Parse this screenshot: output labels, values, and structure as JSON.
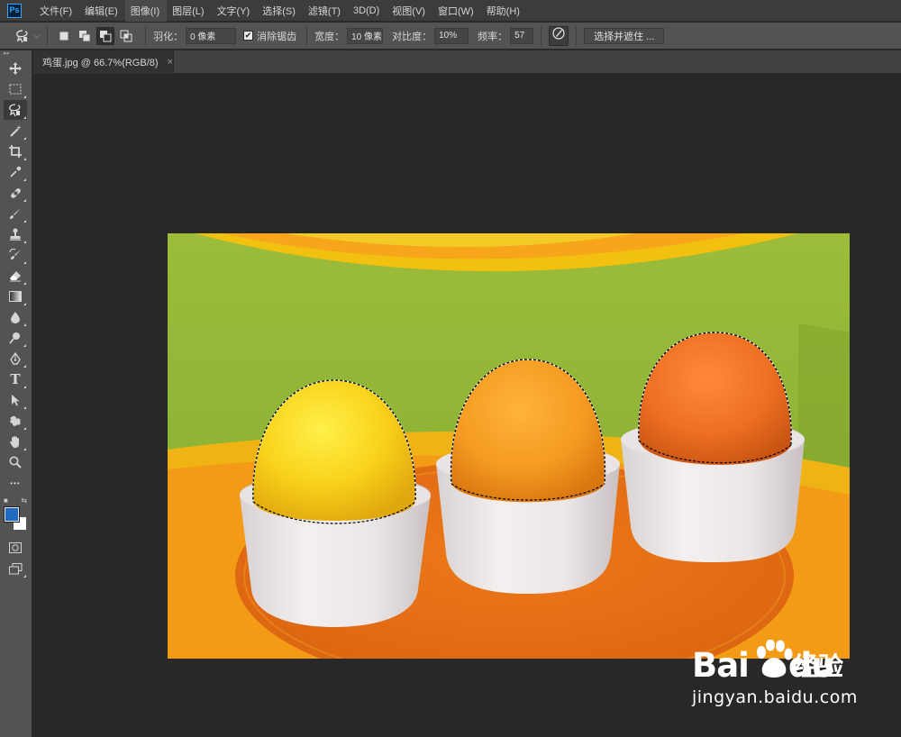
{
  "app": {
    "logo_text": "Ps",
    "menu": [
      {
        "label": "文件(F)"
      },
      {
        "label": "编辑(E)"
      },
      {
        "label": "图像(I)"
      },
      {
        "label": "图层(L)"
      },
      {
        "label": "文字(Y)"
      },
      {
        "label": "选择(S)"
      },
      {
        "label": "滤镜(T)"
      },
      {
        "label": "3D(D)"
      },
      {
        "label": "视图(V)"
      },
      {
        "label": "窗口(W)"
      },
      {
        "label": "帮助(H)"
      }
    ],
    "active_menu": "图像(I)"
  },
  "options": {
    "tool_icon": "magnetic-lasso-icon",
    "selection_modes": [
      "new-selection",
      "add-to-selection",
      "subtract-from-selection",
      "intersect-with-selection"
    ],
    "selected_mode": "subtract-from-selection",
    "feather_label": "羽化：",
    "feather_value": "0 像素",
    "antialias_label": "消除锯齿",
    "antialias_checked": true,
    "width_label": "宽度：",
    "width_value": "10 像素",
    "contrast_label": "对比度：",
    "contrast_value": "10%",
    "frequency_label": "频率：",
    "frequency_value": "57",
    "pen_pressure_icon": "pen-pressure-icon",
    "select_mask_label": "选择并遮住 ..."
  },
  "toolbox": {
    "grip": "▸▸",
    "tools": [
      {
        "name": "move-tool",
        "icon": "move-icon"
      },
      {
        "name": "marquee-tool",
        "icon": "rect-marquee-icon"
      },
      {
        "name": "lasso-tool",
        "icon": "magnetic-lasso-icon",
        "active": true
      },
      {
        "name": "magic-wand-tool",
        "icon": "magic-wand-icon"
      },
      {
        "name": "crop-tool",
        "icon": "crop-icon"
      },
      {
        "name": "eyedropper-tool",
        "icon": "eyedropper-icon"
      },
      {
        "name": "healing-brush-tool",
        "icon": "bandage-icon"
      },
      {
        "name": "brush-tool",
        "icon": "brush-icon"
      },
      {
        "name": "stamp-tool",
        "icon": "stamp-icon"
      },
      {
        "name": "history-brush-tool",
        "icon": "history-brush-icon"
      },
      {
        "name": "eraser-tool",
        "icon": "eraser-icon"
      },
      {
        "name": "gradient-tool",
        "icon": "gradient-icon"
      },
      {
        "name": "blur-tool",
        "icon": "drop-icon"
      },
      {
        "name": "dodge-tool",
        "icon": "dodge-icon"
      },
      {
        "name": "pen-tool",
        "icon": "pen-icon"
      },
      {
        "name": "type-tool",
        "icon": "type-icon",
        "glyph": "T"
      },
      {
        "name": "path-selection-tool",
        "icon": "arrow-icon"
      },
      {
        "name": "shape-tool",
        "icon": "custom-shape-icon"
      },
      {
        "name": "hand-tool",
        "icon": "hand-icon"
      },
      {
        "name": "zoom-tool",
        "icon": "zoom-icon"
      },
      {
        "name": "more-tools",
        "icon": "ellipsis-icon",
        "glyph": "•••"
      }
    ],
    "foreground_color": "#1e6bc0",
    "background_color": "#ffffff",
    "quick_mask_icon": "quick-mask-icon",
    "screen_mode_icon": "screen-mode-icon"
  },
  "document_tab": {
    "title": "鸡蛋.jpg @ 66.7%(RGB/8)",
    "close": "×"
  },
  "watermark": {
    "logo_a": "Bai",
    "logo_b": "du",
    "cn": "经验",
    "url": "jingyan.baidu.com"
  }
}
